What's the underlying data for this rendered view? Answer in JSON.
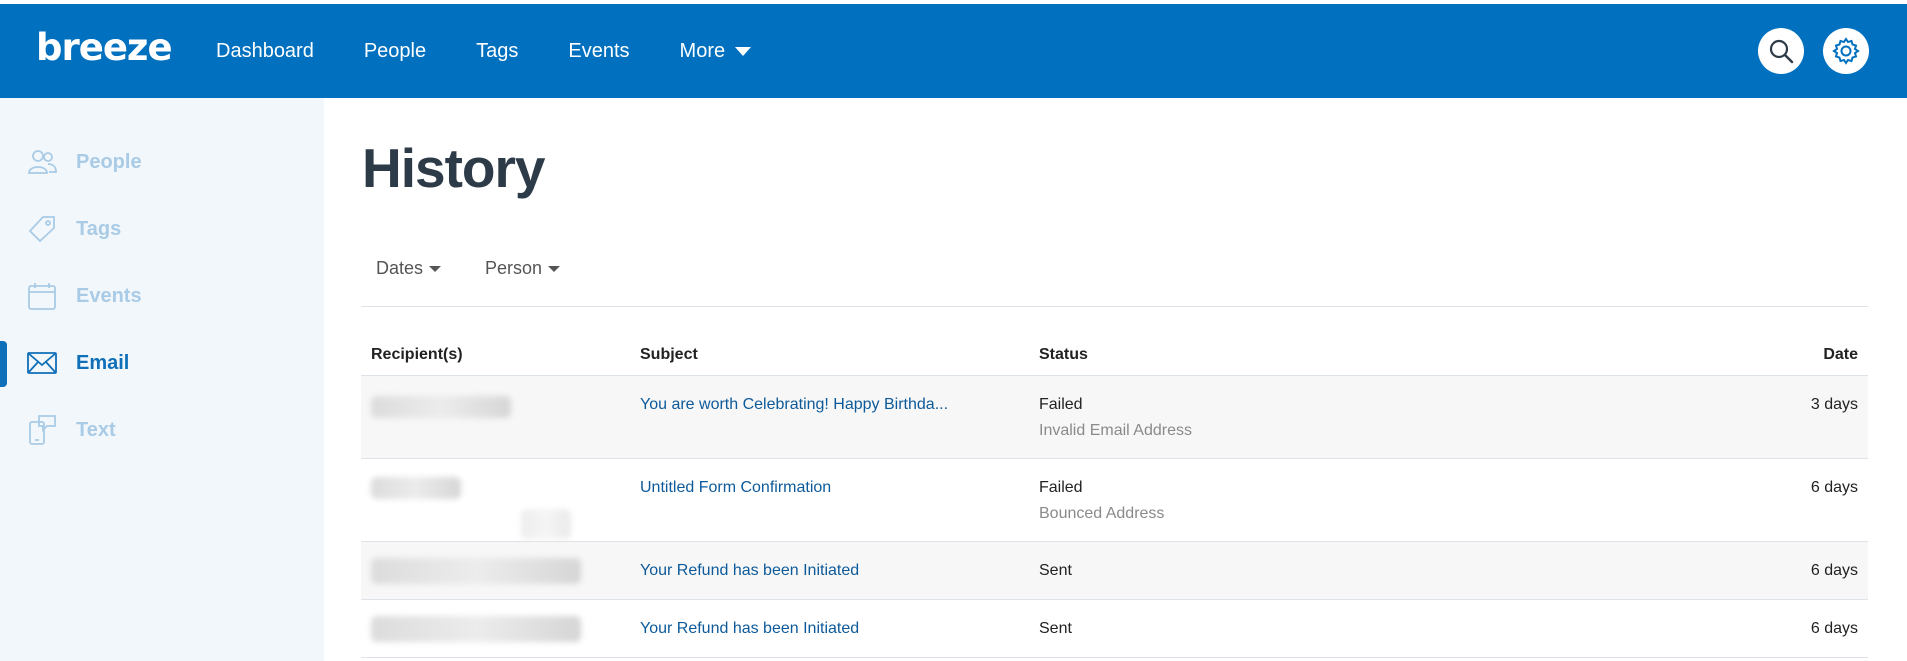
{
  "header": {
    "logo": "breeze",
    "nav": [
      "Dashboard",
      "People",
      "Tags",
      "Events",
      "More"
    ],
    "search_icon": "search-icon",
    "settings_icon": "gear-icon"
  },
  "sidebar": {
    "items": [
      {
        "label": "People",
        "icon": "people-icon"
      },
      {
        "label": "Tags",
        "icon": "tag-icon"
      },
      {
        "label": "Events",
        "icon": "calendar-icon"
      },
      {
        "label": "Email",
        "icon": "envelope-icon",
        "active": true
      },
      {
        "label": "Text",
        "icon": "phone-chat-icon"
      }
    ]
  },
  "main": {
    "title": "History",
    "filters": [
      "Dates",
      "Person"
    ],
    "columns": {
      "recipient": "Recipient(s)",
      "subject": "Subject",
      "status": "Status",
      "date": "Date"
    },
    "rows": [
      {
        "subject": "You are worth Celebrating! Happy Birthda...",
        "status": "Failed",
        "status_detail": "Invalid Email Address",
        "date": "3 days"
      },
      {
        "subject": "Untitled Form Confirmation",
        "status": "Failed",
        "status_detail": "Bounced Address",
        "date": "6 days"
      },
      {
        "subject": "Your Refund has been Initiated",
        "status": "Sent",
        "status_detail": "",
        "date": "6 days"
      },
      {
        "subject": "Your Refund has been Initiated",
        "status": "Sent",
        "status_detail": "",
        "date": "6 days"
      }
    ]
  },
  "colors": {
    "brand": "#0070bf",
    "sidebar_bg": "#f2f7fb",
    "sidebar_inactive": "#a9cbe6",
    "sidebar_active": "#0f6fb8",
    "link": "#0d5a9a"
  }
}
